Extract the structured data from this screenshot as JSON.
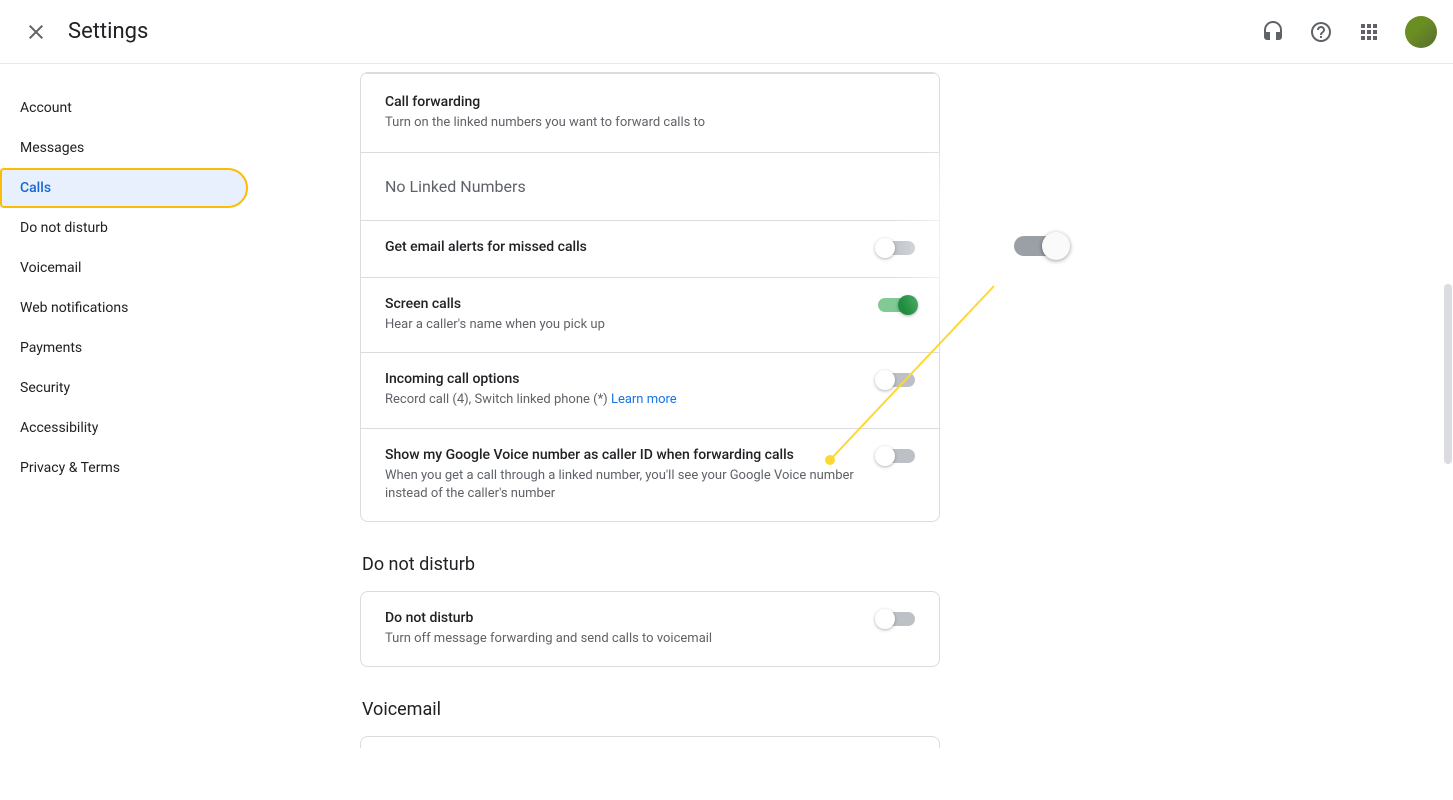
{
  "header": {
    "title": "Settings"
  },
  "sidebar": {
    "items": [
      {
        "label": "Account"
      },
      {
        "label": "Messages"
      },
      {
        "label": "Calls"
      },
      {
        "label": "Do not disturb"
      },
      {
        "label": "Voicemail"
      },
      {
        "label": "Web notifications"
      },
      {
        "label": "Payments"
      },
      {
        "label": "Security"
      },
      {
        "label": "Accessibility"
      },
      {
        "label": "Privacy & Terms"
      }
    ],
    "active_index": 2
  },
  "settings": {
    "call_forwarding": {
      "title": "Call forwarding",
      "subtitle": "Turn on the linked numbers you want to forward calls to",
      "linked_msg": "No Linked Numbers"
    },
    "email_alerts": {
      "title": "Get email alerts for missed calls",
      "on": false
    },
    "screen_calls": {
      "title": "Screen calls",
      "subtitle": "Hear a caller's name when you pick up",
      "on": true
    },
    "incoming_options": {
      "title": "Incoming call options",
      "subtitle_pre": "Record call (4), Switch linked phone (*) ",
      "learn_more": "Learn more",
      "on": false
    },
    "show_caller_id": {
      "title": "Show my Google Voice number as caller ID when forwarding calls",
      "subtitle": "When you get a call through a linked number, you'll see your Google Voice number instead of the caller's number",
      "on": false
    },
    "dnd_section_heading": "Do not disturb",
    "dnd": {
      "title": "Do not disturb",
      "subtitle": "Turn off message forwarding and send calls to voicemail",
      "on": false
    },
    "voicemail_section_heading": "Voicemail"
  },
  "highlight": {
    "toggle_on": false,
    "accent_color": "#fdd835"
  }
}
